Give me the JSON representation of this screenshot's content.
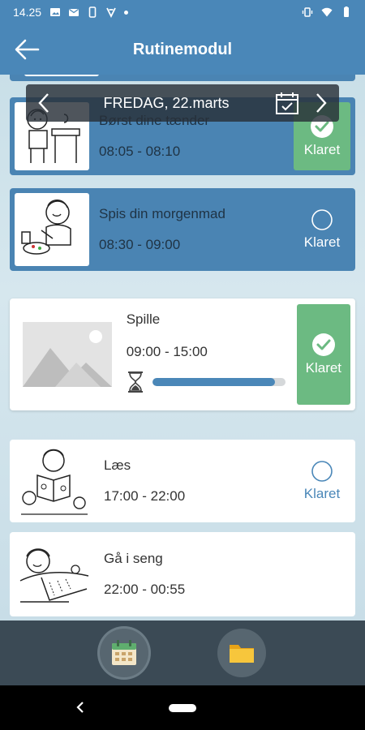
{
  "status_bar": {
    "time": "14.25",
    "icons_left": [
      "photo-icon",
      "mail-icon",
      "phone-icon",
      "app-icon",
      "dot-icon"
    ],
    "icons_right": [
      "vibrate-icon",
      "wifi-icon",
      "battery-icon"
    ]
  },
  "app_bar": {
    "title": "Rutinemodul",
    "back_icon": "arrow-left-icon"
  },
  "date_bar": {
    "date": "FREDAG, 22.marts",
    "prev_icon": "chevron-left-icon",
    "next_icon": "chevron-right-icon",
    "calendar_icon": "calendar-check-icon"
  },
  "routines": [
    {
      "name": "Børst dine tænder",
      "time": "08:05 - 08:10",
      "status": "Klaret",
      "done": true,
      "highlight": true
    },
    {
      "name": "Spis din morgenmad",
      "time": "08:30 - 09:00",
      "status": "Klaret",
      "done": false,
      "highlight": true
    },
    {
      "name": "Spille",
      "time": "09:00 - 15:00",
      "status": "Klaret",
      "done": true,
      "active": true,
      "progress": 0.92
    },
    {
      "name": "Læs",
      "time": "17:00 - 22:00",
      "status": "Klaret",
      "done": false
    },
    {
      "name": "Gå i seng",
      "time": "22:00 - 00:55"
    }
  ],
  "bottom_nav": {
    "items": [
      "calendar-icon",
      "folder-icon"
    ]
  },
  "colors": {
    "primary": "#4a87b8",
    "done_green": "#6cba82",
    "nav_bg": "#3b4a55"
  }
}
